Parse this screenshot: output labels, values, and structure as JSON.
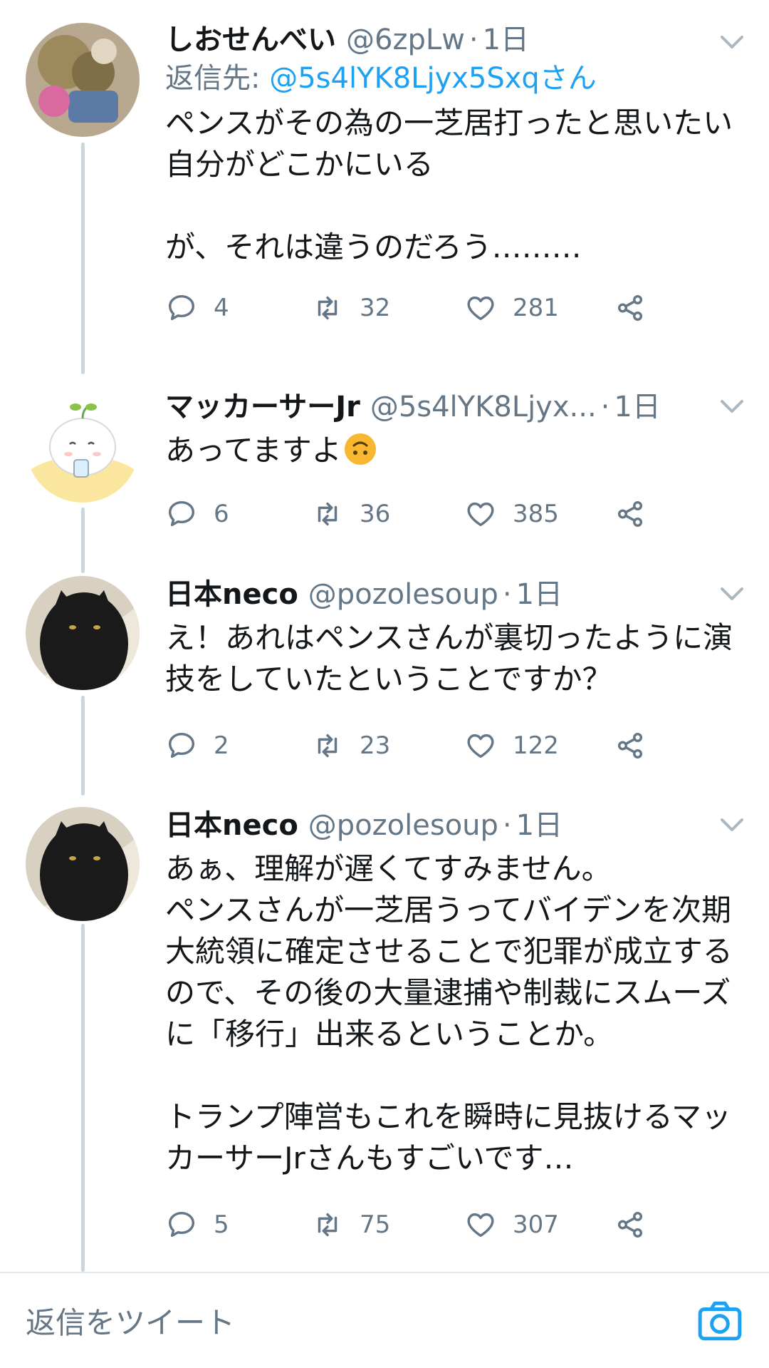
{
  "tweets": [
    {
      "name": "しおせんべい",
      "handle": "@6zpLw",
      "dot": "·",
      "time": "1日",
      "reply_prefix": "返信先: ",
      "reply_mention": "@5s4lYK8Ljyx5Sxqさん",
      "text": "ペンスがその為の一芝居打ったと思いたい自分がどこかにいる\n\nが、それは違うのだろう………",
      "replies": "4",
      "retweets": "32",
      "likes": "281"
    },
    {
      "name": "マッカーサーJr",
      "handle": "@5s4lYK8Ljyx...",
      "dot": "·",
      "time": "1日",
      "text": "あってますよ",
      "replies": "6",
      "retweets": "36",
      "likes": "385"
    },
    {
      "name": "日本neco",
      "handle": "@pozolesoup",
      "dot": "·",
      "time": "1日",
      "text": "え！あれはペンスさんが裏切ったように演技をしていたということですか？",
      "replies": "2",
      "retweets": "23",
      "likes": "122"
    },
    {
      "name": "日本neco",
      "handle": "@pozolesoup",
      "dot": "·",
      "time": "1日",
      "text": "あぁ、理解が遅くてすみません。\nペンスさんが一芝居うってバイデンを次期大統領に確定させることで犯罪が成立するので、その後の大量逮捕や制裁にスムーズに「移行」出来るということか。\n\nトランプ陣営もこれを瞬時に見抜けるマッカーサーJrさんもすごいです…",
      "replies": "5",
      "retweets": "75",
      "likes": "307"
    }
  ],
  "composer": {
    "placeholder": "返信をツイート"
  },
  "colors": {
    "link": "#1da1f2",
    "secondary": "#657786",
    "thread_line": "#ccd6dd"
  }
}
